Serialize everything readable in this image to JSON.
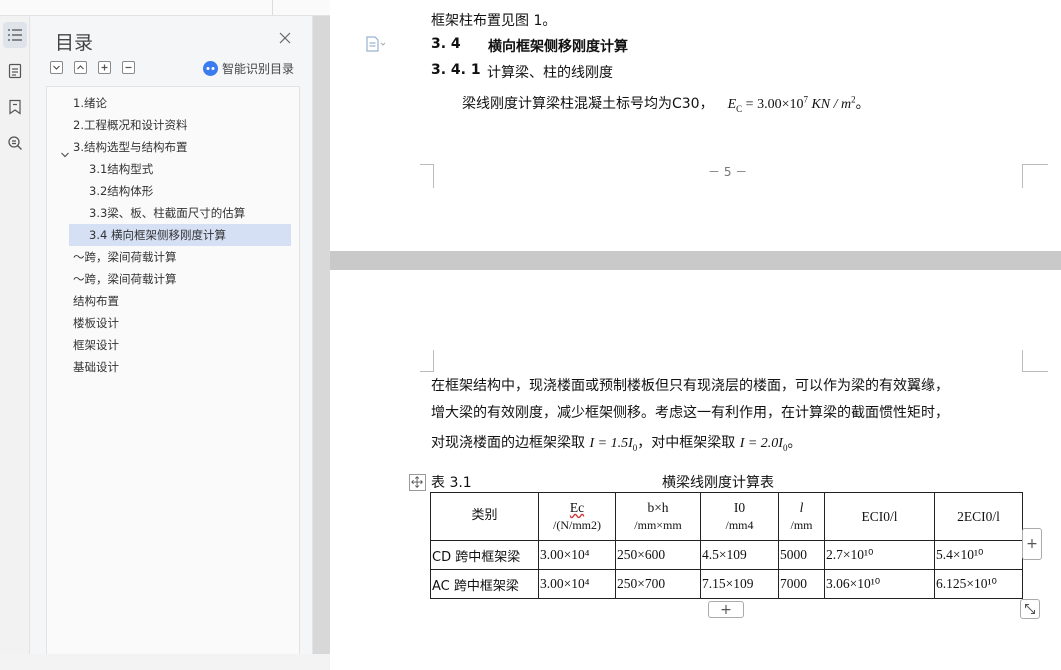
{
  "sidebar_rail": {
    "icons": [
      "toc-list-icon",
      "document-icon",
      "bookmark-icon",
      "find-replace-icon"
    ]
  },
  "toc": {
    "title": "目录",
    "smart_label": "智能识别目录",
    "toolbar_icons": [
      "collapse-all-icon",
      "expand-all-icon",
      "add-item-icon",
      "remove-item-icon"
    ],
    "items": [
      {
        "label": "1.绪论",
        "level": 1
      },
      {
        "label": "2.工程概况和设计资料",
        "level": 1
      },
      {
        "label": "3.结构选型与结构布置",
        "level": 1,
        "expanded": true
      },
      {
        "label": "3.1结构型式",
        "level": 2
      },
      {
        "label": "3.2结构体形",
        "level": 2
      },
      {
        "label": "3.3梁、板、柱截面尺寸的估算",
        "level": 2
      },
      {
        "label": "3.4  横向框架侧移刚度计算",
        "level": 2,
        "selected": true
      },
      {
        "label": "～跨，梁间荷载计算",
        "level": 1
      },
      {
        "label": "～跨，梁间荷载计算",
        "level": 1
      },
      {
        "label": "结构布置",
        "level": 1
      },
      {
        "label": "楼板设计",
        "level": 1
      },
      {
        "label": "框架设计",
        "level": 1
      },
      {
        "label": "基础设计",
        "level": 1
      }
    ]
  },
  "page1": {
    "cut_line": "框架柱布置见图 1。",
    "section_num": "3. 4",
    "section_title": "横向框架侧移刚度计算",
    "subsection_num": "3. 4. 1",
    "subsection_title": "计算梁、柱的线刚度",
    "body_text": "梁线刚度计算梁柱混凝土标号均为C30，",
    "formula": "E_C = 3.00×10^7 KN / m^2",
    "formula_base": "E",
    "formula_sub": "C",
    "formula_eq": " = 3.00×10",
    "formula_exp": "7",
    "formula_unit": " KN / m",
    "formula_unit_exp": "2",
    "formula_end": "。",
    "page_number": "－ 5 －"
  },
  "page2": {
    "para_line1": "在框架结构中，现浇楼面或预制楼板但只有现浇层的楼面，可以作为梁的有效翼缘，",
    "para_line2": "增大梁的有效刚度，减少框架侧移。考虑这一有利作用，在计算梁的截面惯性矩时，",
    "para_line3_a": "对现浇楼面的边框架梁取 ",
    "para_line3_f1": "I = 1.5I",
    "para_line3_f1_sub": "0",
    "para_line3_b": "，对中框架梁取 ",
    "para_line3_f2": "I = 2.0I",
    "para_line3_f2_sub": "0",
    "para_line3_end": "。",
    "table_label": "表 3.1",
    "table_name": "横梁线刚度计算表",
    "table": {
      "headers": [
        {
          "line1": "类别",
          "line2": ""
        },
        {
          "line1": "Ec",
          "line2": "/(N/mm2)"
        },
        {
          "line1": "b×h",
          "line2": "/mm×mm"
        },
        {
          "line1": "I0",
          "line2": "/mm4"
        },
        {
          "line1": "l",
          "line2": "/mm"
        },
        {
          "line1": "ECI0/l",
          "line2": ""
        },
        {
          "line1": "2ECI0/l",
          "line2": ""
        }
      ],
      "rows": [
        [
          "CD 跨中框架梁",
          "3.00×10⁴",
          "250×600",
          "4.5×109",
          "5000",
          "2.7×10¹⁰",
          "5.4×10¹⁰"
        ],
        [
          "AC 跨中框架梁",
          "3.00×10⁴",
          "250×700",
          "7.15×109",
          "7000",
          "3.06×10¹⁰",
          "6.125×10¹⁰"
        ]
      ]
    },
    "add_col_label": "+",
    "add_row_label": "+"
  }
}
